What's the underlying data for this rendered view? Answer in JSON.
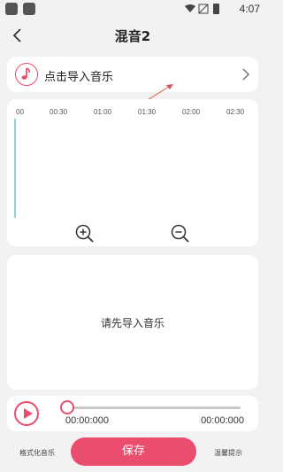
{
  "status_bar": {
    "time": "4:07"
  },
  "header": {
    "title": "混音2"
  },
  "import": {
    "label": "点击导入音乐"
  },
  "timeline": {
    "ticks": [
      "00",
      "00:30",
      "01:00",
      "01:30",
      "02:00",
      "02:30"
    ]
  },
  "empty_state": {
    "text": "请先导入音乐"
  },
  "player": {
    "current_time": "00:00:000",
    "total_time": "00:00:000",
    "progress_fraction": 0
  },
  "bottom": {
    "left_label": "格式化音乐",
    "save_label": "保存",
    "right_label": "温馨提示"
  },
  "colors": {
    "accent": "#ea4d6d",
    "playhead": "#8fd6d2"
  }
}
